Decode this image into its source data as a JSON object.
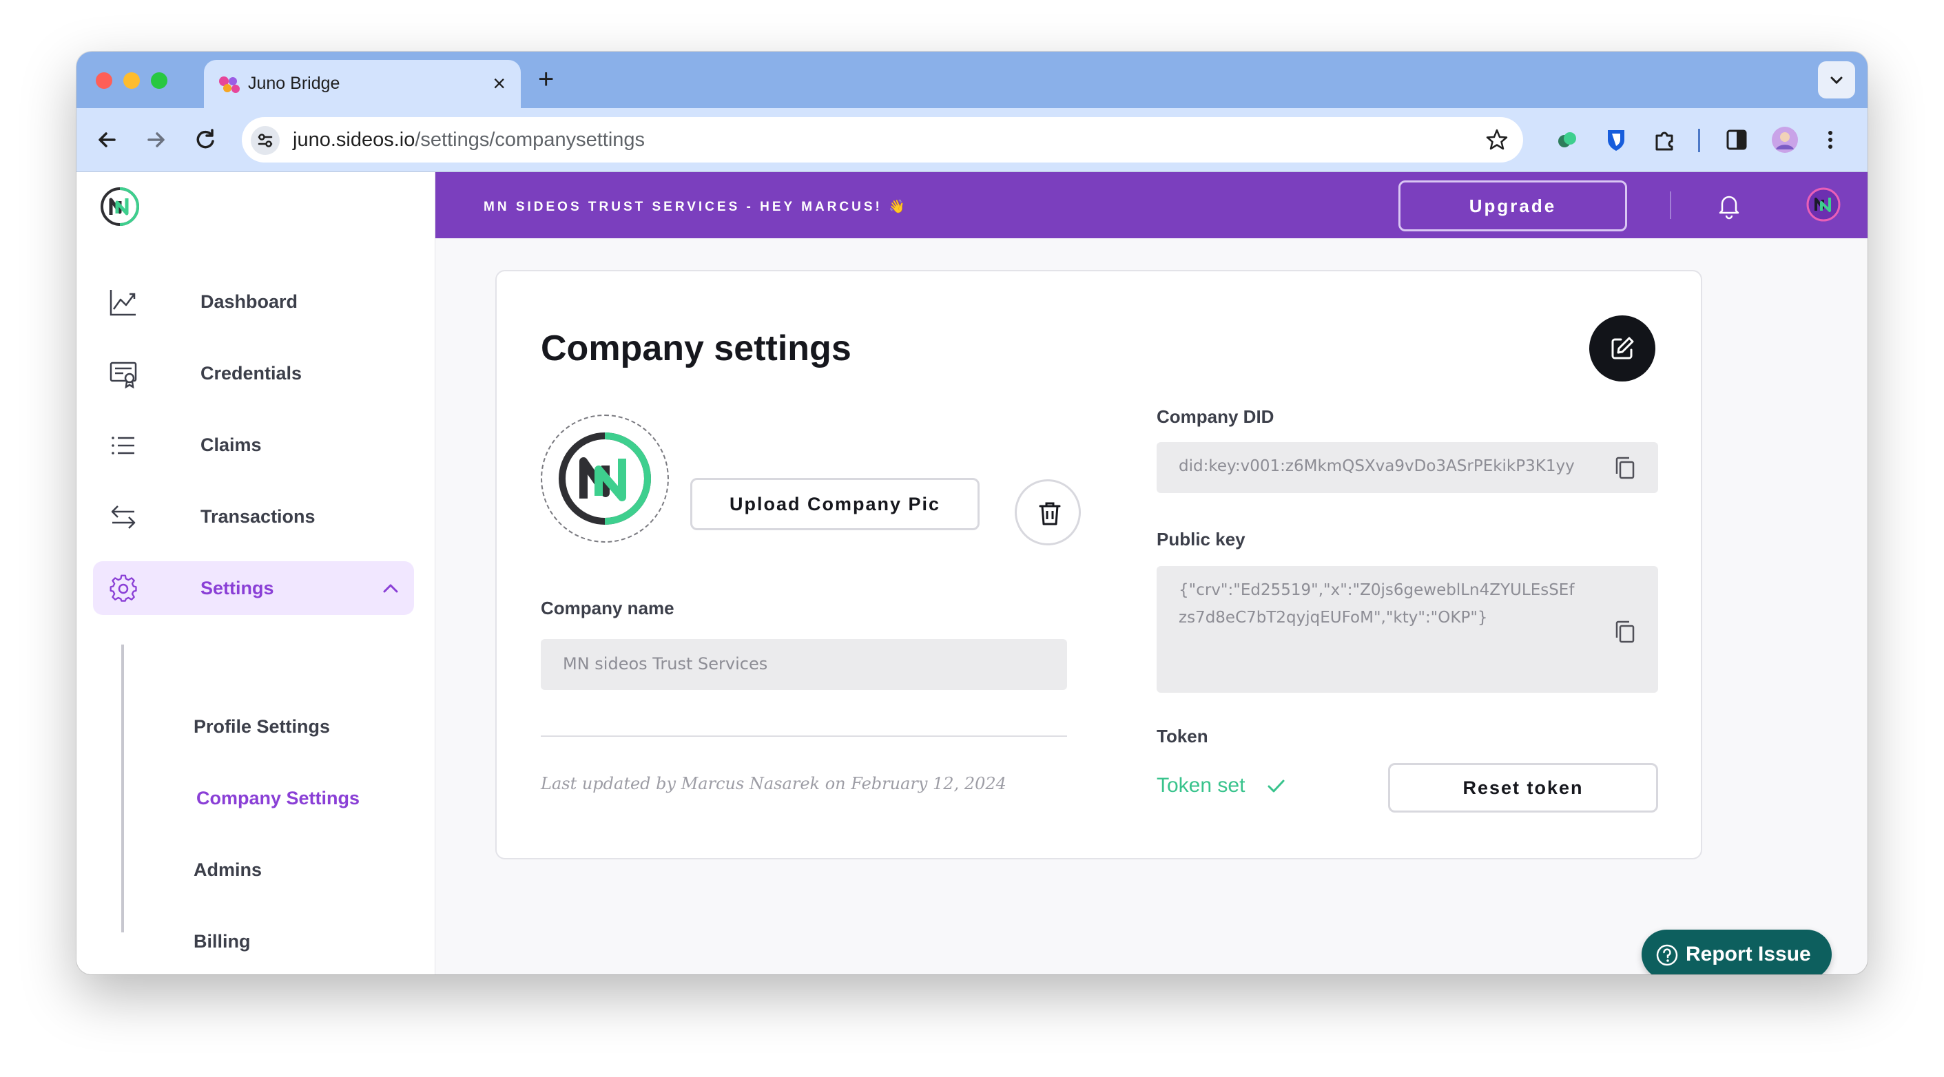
{
  "browser": {
    "tab_title": "Juno Bridge",
    "tab_close": "×",
    "new_tab": "+",
    "url_host": "juno.sideos.io",
    "url_path": "/settings/companysettings"
  },
  "sidebar": {
    "items": [
      {
        "label": "Dashboard",
        "icon": "chart-line-icon"
      },
      {
        "label": "Credentials",
        "icon": "certificate-icon"
      },
      {
        "label": "Claims",
        "icon": "list-icon"
      },
      {
        "label": "Transactions",
        "icon": "arrows-exchange-icon"
      },
      {
        "label": "Settings",
        "icon": "gear-icon"
      }
    ],
    "settings_sub": [
      {
        "label": "Profile Settings"
      },
      {
        "label": "Company Settings"
      },
      {
        "label": "Admins"
      },
      {
        "label": "Billing"
      }
    ]
  },
  "banner": {
    "text": "MN SIDEOS TRUST SERVICES - HEY MARCUS! 👋",
    "upgrade_label": "Upgrade"
  },
  "settings": {
    "title": "Company settings",
    "upload_label": "Upload Company Pic",
    "company_name_label": "Company name",
    "company_name_value": "MN sideos Trust Services",
    "last_updated": "Last updated by Marcus Nasarek on February 12, 2024",
    "did_label": "Company DID",
    "did_value": "did:key:v001:z6MkmQSXva9vDo3ASrPEkikP3K1yy",
    "public_key_label": "Public key",
    "public_key_line1": "{\"crv\":\"Ed25519\",\"x\":\"Z0js6geweblLn4ZYULEsSEf",
    "public_key_line2": "zs7d8eC7bT2qyjqEUFoM\",\"kty\":\"OKP\"}",
    "token_label": "Token",
    "token_status": "Token set",
    "reset_label": "Reset token"
  },
  "report": {
    "label": "Report Issue"
  },
  "colors": {
    "accent_purple": "#7b3fbe",
    "active_text": "#8a3fd6",
    "token_green": "#38c38c",
    "report_teal": "#0d5f5e"
  }
}
